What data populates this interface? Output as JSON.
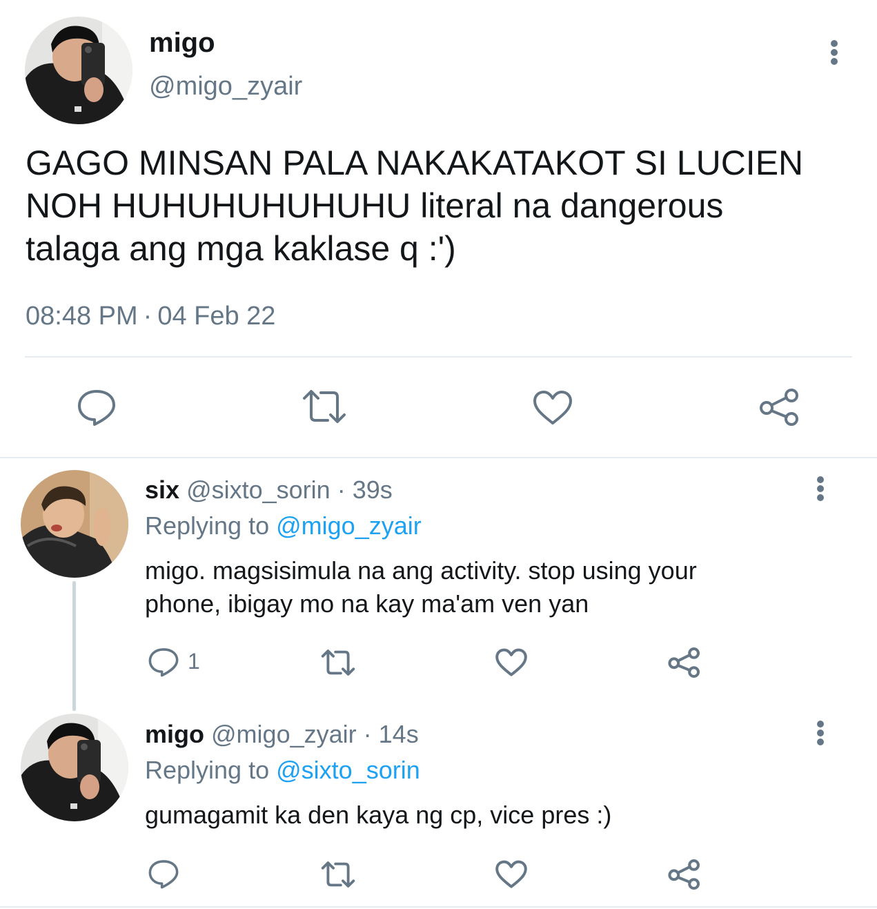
{
  "main_tweet": {
    "display_name": "migo",
    "handle": "@migo_zyair",
    "text": "GAGO MINSAN PALA NAKAKATAKOT SI LUCIEN\nNOH HUHUHUHUHUHU literal na dangerous\ntalaga ang mga kaklase q :')",
    "time": "08:48 PM",
    "separator": "·",
    "date": "04 Feb 22",
    "actions": {
      "reply_icon": "reply-icon",
      "retweet_icon": "retweet-icon",
      "like_icon": "heart-icon",
      "share_icon": "share-icon"
    }
  },
  "replies": [
    {
      "display_name": "six",
      "handle": "@sixto_sorin",
      "separator": "·",
      "time": "39s",
      "replying_prefix": "Replying to",
      "replying_to": "@migo_zyair",
      "text": "migo. magsisimula na ang activity. stop using your\nphone, ibigay mo na kay ma'am ven yan",
      "reply_count": "1"
    },
    {
      "display_name": "migo",
      "handle": "@migo_zyair",
      "separator": "·",
      "time": "14s",
      "replying_prefix": "Replying to",
      "replying_to": "@sixto_sorin",
      "text": "gumagamit ka den kaya ng cp, vice pres :)",
      "reply_count": ""
    }
  ],
  "colors": {
    "primary_text": "#14171a",
    "secondary_text": "#657786",
    "link": "#1da1f2",
    "divider": "#e6ecf0",
    "thread_line": "#ccd6dd"
  }
}
